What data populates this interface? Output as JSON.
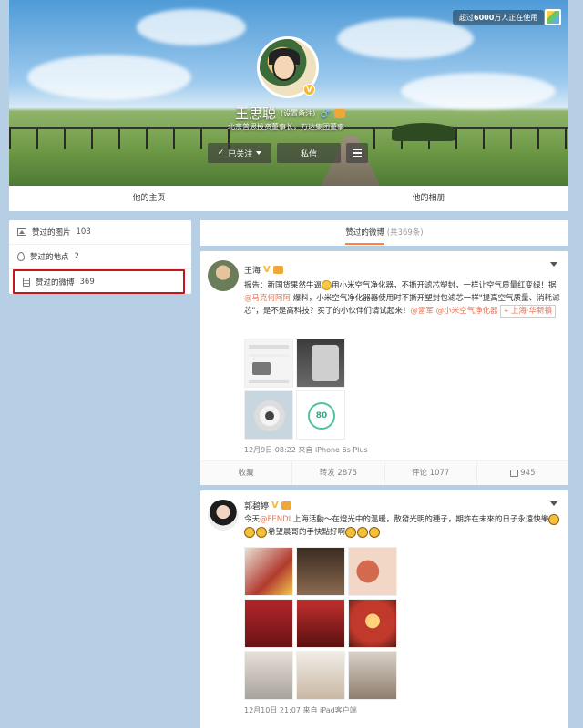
{
  "header": {
    "using_badge": {
      "prefix": "超过",
      "count": "6000",
      "suffix": "万人正在使用"
    },
    "profile": {
      "name": "王思聪",
      "remark": "(设置备注)",
      "bio": "北京普思投资董事长，万达集团董事"
    },
    "buttons": {
      "follow": "已关注",
      "message": "私信"
    },
    "tabs": [
      "他的主页",
      "他的相册"
    ]
  },
  "sidebar": {
    "items": [
      {
        "label": "赞过的图片",
        "count": "103",
        "icon": "image-icon"
      },
      {
        "label": "赞过的地点",
        "count": "2",
        "icon": "location-pin-icon"
      },
      {
        "label": "赞过的微博",
        "count": "369",
        "icon": "document-icon",
        "active": true
      }
    ]
  },
  "main": {
    "header_title": "赞过的微博",
    "header_sub": "(共369条)",
    "posts": [
      {
        "user": "王海",
        "text_part1": "报告：新国货果然牛逼",
        "text_part2": "用小米空气净化器，不撕开滤芯塑封，一样让空气质量红变绿！据",
        "mention1": "@马克何阿阿",
        "text_part3": " 爆料，小米空气净化器器使用时不撕开塑封包滤芯一样\"提高空气质量、消耗滤芯\"，是不是高科技？买了的小伙伴们请试起来！",
        "mention2": "@雷军",
        "mention3": "@小米空气净化器",
        "location": "上海·华新镇",
        "meta": "12月9日 08:22 来自 iPhone 6s Plus",
        "gauge_value": "80",
        "actions": {
          "fav": "收藏",
          "repost": "转发 2875",
          "comment": "评论 1077",
          "like": "945"
        }
      },
      {
        "user": "郭碧婷",
        "text_part1": "今天",
        "mention1": "@FENDI",
        "text_part2": " 上海活動～在燈光中的溫暖，散發光明的種子，期許在未來的日子永遠快樂",
        "text_part3": "希望晨哥的手快點好啊",
        "meta": "12月10日 21:07 来自 iPad客户端"
      }
    ]
  },
  "colors": {
    "accent": "#eb7350",
    "highlight_border": "#c4161c",
    "tab_underline": "#ff8140",
    "background": "#b7cfe4"
  }
}
